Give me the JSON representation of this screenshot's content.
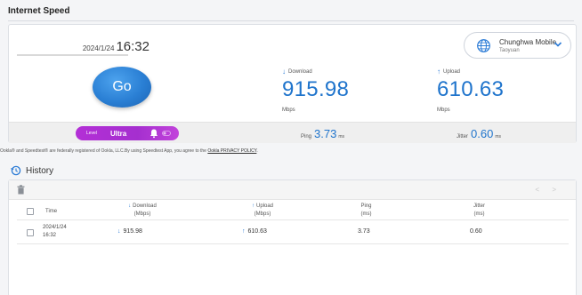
{
  "section": {
    "title": "Internet Speed"
  },
  "test": {
    "date": "2024/1/24",
    "time": "16:32",
    "go_label": "Go"
  },
  "server": {
    "provider": "Chunghwa Mobile",
    "city": "Taoyuan",
    "icon": "globe-icon"
  },
  "download": {
    "label": "Download",
    "value": "915.98",
    "unit": "Mbps"
  },
  "upload": {
    "label": "Upload",
    "value": "610.63",
    "unit": "Mbps"
  },
  "level": {
    "label": "Level",
    "value": "Ultra"
  },
  "ping": {
    "label": "Ping",
    "value": "3.73",
    "unit": "ms"
  },
  "jitter": {
    "label": "Jitter",
    "value": "0.60",
    "unit": "ms"
  },
  "disclaimer": {
    "text": "Ookla® and Speedtest® are federally registered of Ookla, LLC.By using Speedtest App, you agree to the ",
    "link": "Ookla PRIVACY POLICY",
    "end": "."
  },
  "history": {
    "title": "History",
    "pager": "< >",
    "columns": {
      "time": "Time",
      "download": "Download",
      "download_unit": "(Mbps)",
      "upload": "Upload",
      "upload_unit": "(Mbps)",
      "ping": "Ping",
      "ping_unit": "(ms)",
      "jitter": "Jitter",
      "jitter_unit": "(ms)"
    },
    "rows": [
      {
        "date": "2024/1/24",
        "time": "16:32",
        "download": "915.98",
        "upload": "610.63",
        "ping": "3.73",
        "jitter": "0.60"
      }
    ]
  },
  "colors": {
    "accent": "#1f74cc",
    "level_pill": "#b32fd6",
    "go_button": "#2a7fd4"
  }
}
